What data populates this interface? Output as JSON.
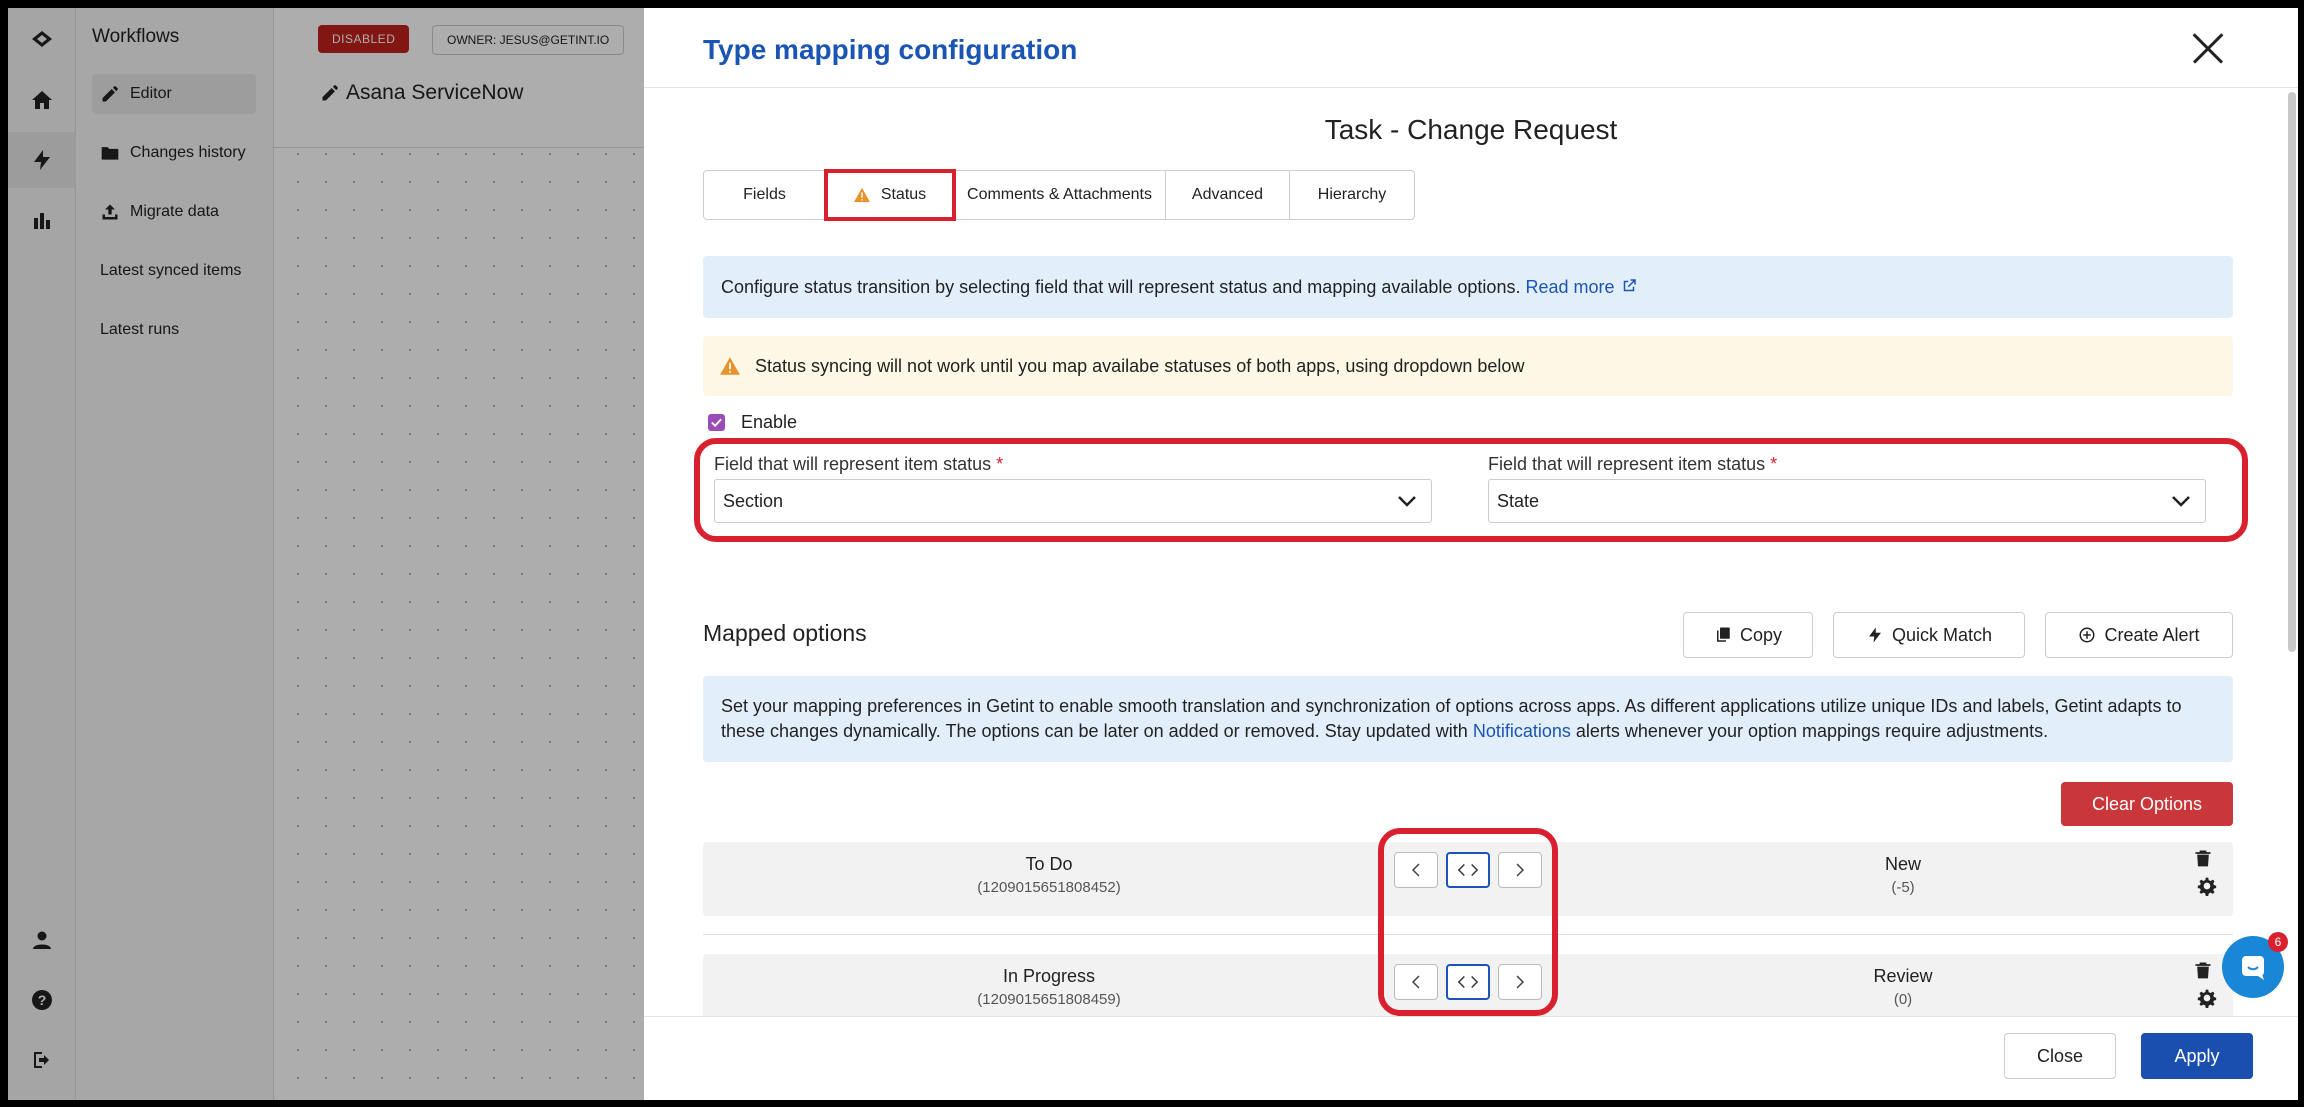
{
  "sidebar": {
    "title": "Workflows",
    "items": [
      {
        "label": "Editor",
        "icon": "pencil-icon"
      },
      {
        "label": "Changes history",
        "icon": "folder-icon"
      },
      {
        "label": "Migrate data",
        "icon": "upload-icon"
      },
      {
        "label": "Latest synced items"
      },
      {
        "label": "Latest runs"
      }
    ]
  },
  "rail": {
    "icons": [
      "logo-icon",
      "home-icon",
      "bolt-icon",
      "bar-chart-icon",
      "user-icon",
      "help-icon",
      "logout-icon"
    ]
  },
  "workflow": {
    "status_badge": "DISABLED",
    "owner_badge": "OWNER: JESUS@GETINT.IO",
    "name": "Asana ServiceNow"
  },
  "modal": {
    "title": "Type mapping configuration",
    "subtitle": "Task - Change Request",
    "tabs": [
      {
        "label": "Fields"
      },
      {
        "label": "Status"
      },
      {
        "label": "Comments & Attachments"
      },
      {
        "label": "Advanced"
      },
      {
        "label": "Hierarchy"
      }
    ],
    "info_text": "Configure status transition by selecting field that will represent status and mapping available options.",
    "read_more": "Read more",
    "warning_text": "Status syncing will not work until you map availabe statuses of both apps, using dropdown below",
    "enable_label": "Enable",
    "enable_checked": true,
    "field_left": {
      "label": "Field that will represent item status",
      "value": "Section"
    },
    "field_right": {
      "label": "Field that will represent item status",
      "value": "State"
    },
    "required_mark": "*",
    "mapped_title": "Mapped options",
    "buttons": {
      "copy": "Copy",
      "quick_match": "Quick Match",
      "create_alert": "Create Alert",
      "clear_options": "Clear Options"
    },
    "mapping_info_1": "Set your mapping preferences in Getint to enable smooth translation and synchronization of options across apps. As different applications utilize unique IDs and labels, Getint adapts to these changes dynamically. The options can be later on added or removed. Stay updated with",
    "mapping_info_link": "Notifications",
    "mapping_info_2": "alerts whenever your option mappings require adjustments.",
    "mappings": [
      {
        "left_name": "To Do",
        "left_id": "(1209015651808452)",
        "right_name": "New",
        "right_id": "(-5)"
      },
      {
        "left_name": "In Progress",
        "left_id": "(1209015651808459)",
        "right_name": "Review",
        "right_id": "(0)"
      }
    ],
    "footer": {
      "close": "Close",
      "apply": "Apply"
    }
  },
  "chat": {
    "badge": "6"
  },
  "colors": {
    "accent": "#1b55b4",
    "danger": "#c9373a",
    "highlight": "#d8202e",
    "checkbox": "#9b4db5"
  }
}
